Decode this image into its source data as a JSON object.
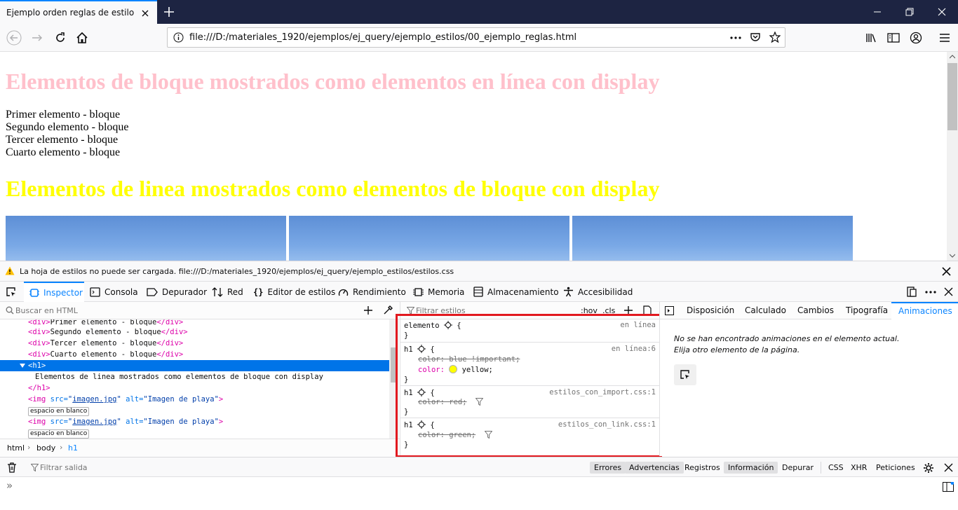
{
  "browser": {
    "tab_title": "Ejemplo orden reglas de estilo",
    "url": "file:///D:/materiales_1920/ejemplos/ej_query/ejemplo_estilos/00_ejemplo_reglas.html"
  },
  "page": {
    "heading1": "Elementos de bloque mostrados como elementos en línea con display",
    "block_items": [
      "Primer elemento - bloque",
      "Segundo elemento - bloque",
      "Tercer elemento - bloque",
      "Cuarto elemento - bloque"
    ],
    "heading2": "Elementos de linea mostrados como elementos de bloque con display",
    "heading1_color": "#ffc0cb",
    "heading2_color": "#ffff00"
  },
  "warning": {
    "text": "La hoja de estilos no puede ser cargada. file:///D:/materiales_1920/ejemplos/ej_query/ejemplo_estilos/estilos.css"
  },
  "devtools": {
    "tabs": [
      "Inspector",
      "Consola",
      "Depurador",
      "Red",
      "Editor de estilos",
      "Rendimiento",
      "Memoria",
      "Almacenamiento",
      "Accesibilidad"
    ],
    "search_html_placeholder": "Buscar en HTML",
    "markup": {
      "lines": [
        {
          "open": "<div>",
          "text": "Primer elemento - bloque",
          "close": "</div>"
        },
        {
          "open": "<div>",
          "text": "Segundo elemento - bloque",
          "close": "</div>"
        },
        {
          "open": "<div>",
          "text": "Tercer elemento - bloque",
          "close": "</div>"
        },
        {
          "open": "<div>",
          "text": "Cuarto elemento - bloque",
          "close": "</div>"
        }
      ],
      "selected": "<h1>",
      "h1_text": "Elementos de linea mostrados como elementos de bloque con display",
      "h1_close": "</h1>",
      "img_tag": "<img",
      "img_src_attr": "src=",
      "img_src_val": "imagen.jpg",
      "img_alt_attr": "alt=",
      "img_alt_val": "\"Imagen de playa\"",
      "img_end": ">",
      "whitespace": "espacio en blanco"
    },
    "breadcrumbs": [
      "html",
      "body",
      "h1"
    ],
    "rules": {
      "filter_placeholder": "Filtrar estilos",
      "hov": ":hov",
      "cls": ".cls",
      "element": {
        "selector": "elemento",
        "source": "en línea"
      },
      "r1": {
        "selector": "h1",
        "source": "en línea:6",
        "p1": "color: blue !important;",
        "p2_name": "color:",
        "p2_value": "yellow;"
      },
      "r2": {
        "selector": "h1",
        "source": "estilos_con_import.css:1",
        "p1": "color: red;"
      },
      "r3": {
        "selector": "h1",
        "source": "estilos_con_link.css:1",
        "p1": "color: green;"
      },
      "open_brace": "{",
      "close_brace": "}"
    },
    "side_tabs": [
      "Disposición",
      "Calculado",
      "Cambios",
      "Tipografía",
      "Animaciones"
    ],
    "animations_msg_1": "No se han encontrado animaciones en el elemento actual.",
    "animations_msg_2": "Elija otro elemento de la página."
  },
  "console": {
    "filter_placeholder": "Filtrar salida",
    "buttons": [
      "Errores",
      "Advertencias",
      "Registros",
      "Información",
      "Depurar",
      "CSS",
      "XHR",
      "Peticiones"
    ],
    "prompt": "»"
  },
  "colors": {
    "accent": "#0a84ff",
    "highlight_box": "#e2191f",
    "swatch_yellow": "#ffff00"
  }
}
